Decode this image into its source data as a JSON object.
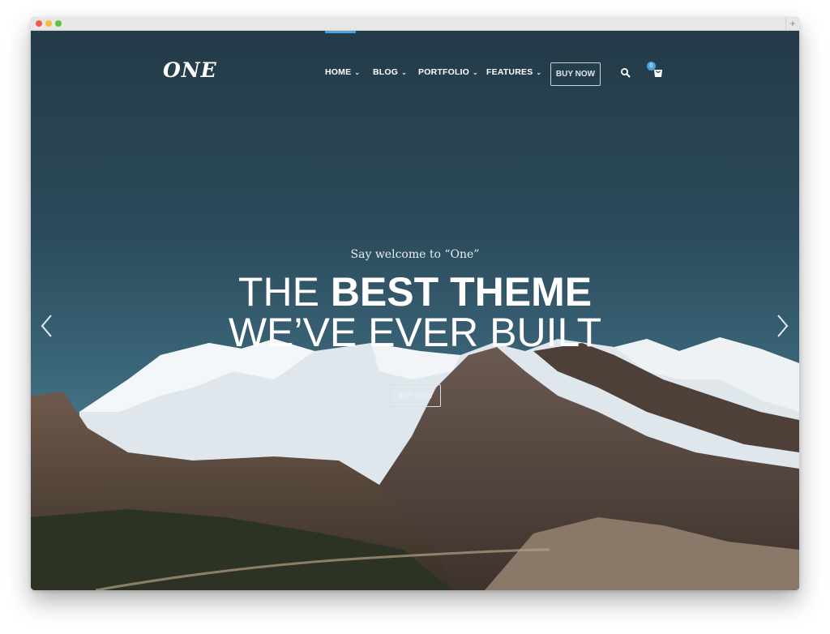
{
  "browser": {
    "new_tab_symbol": "+"
  },
  "site": {
    "logo": "ONE"
  },
  "nav": {
    "items": [
      {
        "label": "HOME",
        "icon": "chevron-down-icon"
      },
      {
        "label": "BLOG",
        "icon": "chevron-down-icon"
      },
      {
        "label": "PORTFOLIO",
        "icon": "chevron-down-icon"
      },
      {
        "label": "FEATURES",
        "icon": "chevron-down-icon"
      }
    ],
    "buy_label": "BUY NOW",
    "cart_count": "0",
    "active_color": "#4aa3df"
  },
  "hero": {
    "subtitle": "Say welcome to “One”",
    "headline_light": "THE ",
    "headline_bold": "BEST THEME",
    "headline_line2": "WE’VE EVER BUILT",
    "button_label": "BUY NOW",
    "prev_icon": "chevron-left-icon",
    "next_icon": "chevron-right-icon"
  }
}
